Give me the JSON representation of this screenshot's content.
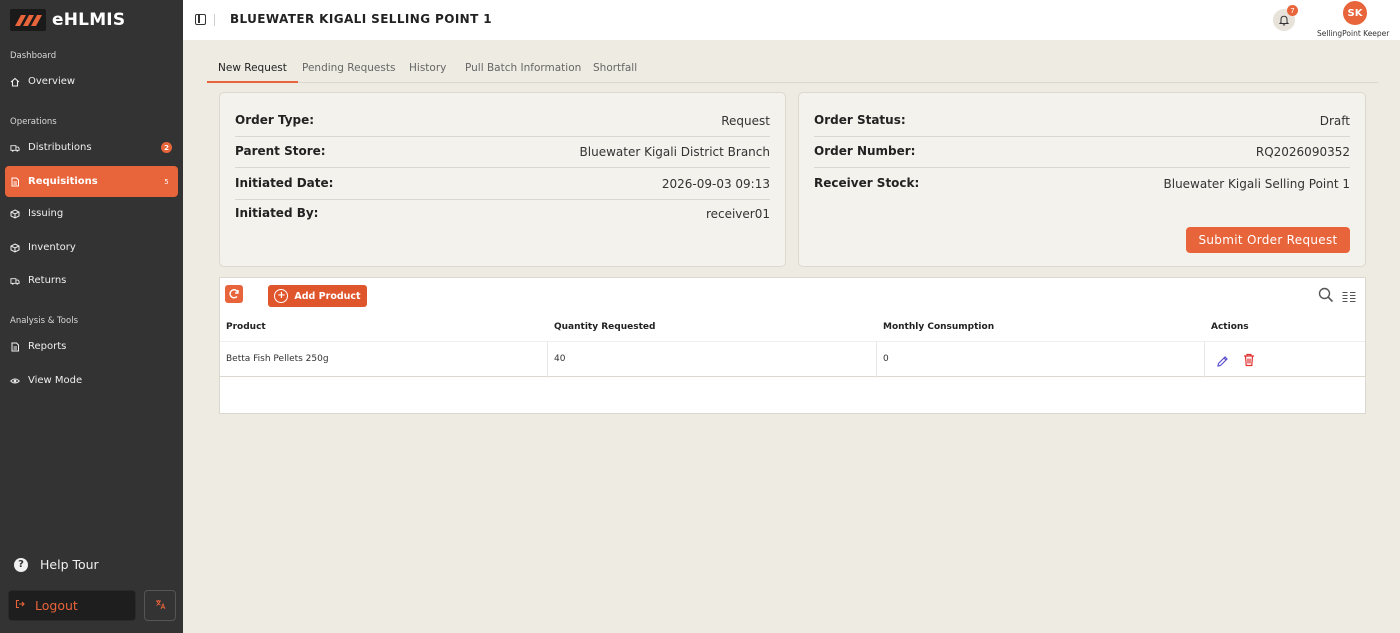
{
  "app": {
    "name": "eHLMIS"
  },
  "sidebar": {
    "sections": [
      {
        "label": "Dashboard"
      },
      {
        "label": "Operations"
      },
      {
        "label": "Analysis & Tools"
      }
    ],
    "items": [
      {
        "label": "Overview",
        "icon": "home-icon"
      },
      {
        "label": "Distributions",
        "icon": "truck-icon",
        "badge": "2"
      },
      {
        "label": "Requisitions",
        "icon": "document-icon",
        "badge": "5",
        "active": true
      },
      {
        "label": "Issuing",
        "icon": "box-icon"
      },
      {
        "label": "Inventory",
        "icon": "box-icon"
      },
      {
        "label": "Returns",
        "icon": "truck-icon"
      },
      {
        "label": "Reports",
        "icon": "document-icon"
      },
      {
        "label": "View Mode",
        "icon": "eye-icon"
      }
    ],
    "help_tour": "Help Tour",
    "logout": "Logout"
  },
  "header": {
    "title": "BLUEWATER KIGALI SELLING POINT 1",
    "notifications": "7",
    "user_initials": "SK",
    "user_role": "SellingPoint Keeper"
  },
  "tabs": [
    {
      "label": "New Request",
      "active": true
    },
    {
      "label": "Pending Requests"
    },
    {
      "label": "History"
    },
    {
      "label": "Pull Batch Information"
    },
    {
      "label": "Shortfall"
    }
  ],
  "order_info": {
    "left": [
      {
        "label": "Order Type:",
        "value": "Request"
      },
      {
        "label": "Parent Store:",
        "value": "Bluewater Kigali District Branch"
      },
      {
        "label": "Initiated Date:",
        "value": "2026-09-03 09:13"
      },
      {
        "label": "Initiated By:",
        "value": "receiver01"
      }
    ],
    "right": [
      {
        "label": "Order Status:",
        "value": "Draft"
      },
      {
        "label": "Order Number:",
        "value": "RQ2026090352"
      },
      {
        "label": "Receiver Stock:",
        "value": "Bluewater Kigali Selling Point 1"
      }
    ],
    "submit_label": "Submit Order Request"
  },
  "products": {
    "add_label": "Add Product",
    "columns": [
      "Product",
      "Quantity Requested",
      "Monthly Consumption",
      "Actions"
    ],
    "rows": [
      {
        "product": "Betta Fish Pellets 250g",
        "quantity": "40",
        "consumption": "0"
      }
    ]
  },
  "colors": {
    "accent": "#e8643a",
    "sidebar": "#333333",
    "background": "#eeebe3"
  }
}
